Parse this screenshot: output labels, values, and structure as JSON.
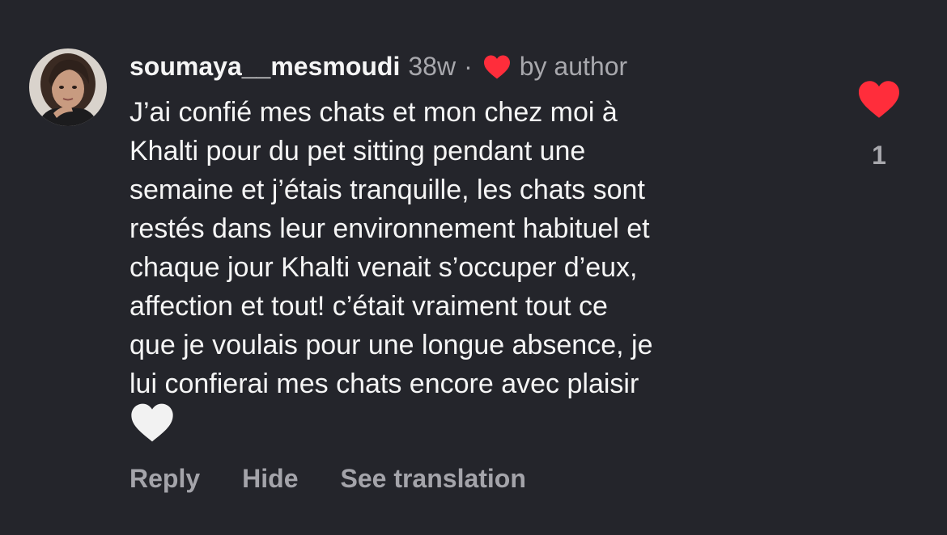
{
  "comment": {
    "username": "soumaya__mesmoudi",
    "time": "38w",
    "separator": "·",
    "author_label": "by author",
    "text": "J’ai confié mes chats et mon chez moi à\nKhalti pour du pet sitting pendant une\nsemaine et j’étais tranquille, les chats sont\nrestés dans leur environnement habituel et\nchaque jour Khalti venait s’occuper d’eux,\naffection et tout! c’était vraiment tout ce\nque je voulais pour une longue absence, je\nlui confierai mes chats encore avec plaisir",
    "trailing_emoji": "white-heart-emoji",
    "like_count": "1",
    "liked": true
  },
  "actions": {
    "reply": "Reply",
    "hide": "Hide",
    "see_translation": "See translation"
  },
  "icons": {
    "author_like": "red-heart-icon",
    "like_button": "red-heart-icon"
  },
  "colors": {
    "background": "#24252b",
    "primary_text": "#f5f5f5",
    "secondary_text": "#a8a8ad",
    "heart_red": "#ff2d3b",
    "emoji_white": "#f2f2f2"
  }
}
